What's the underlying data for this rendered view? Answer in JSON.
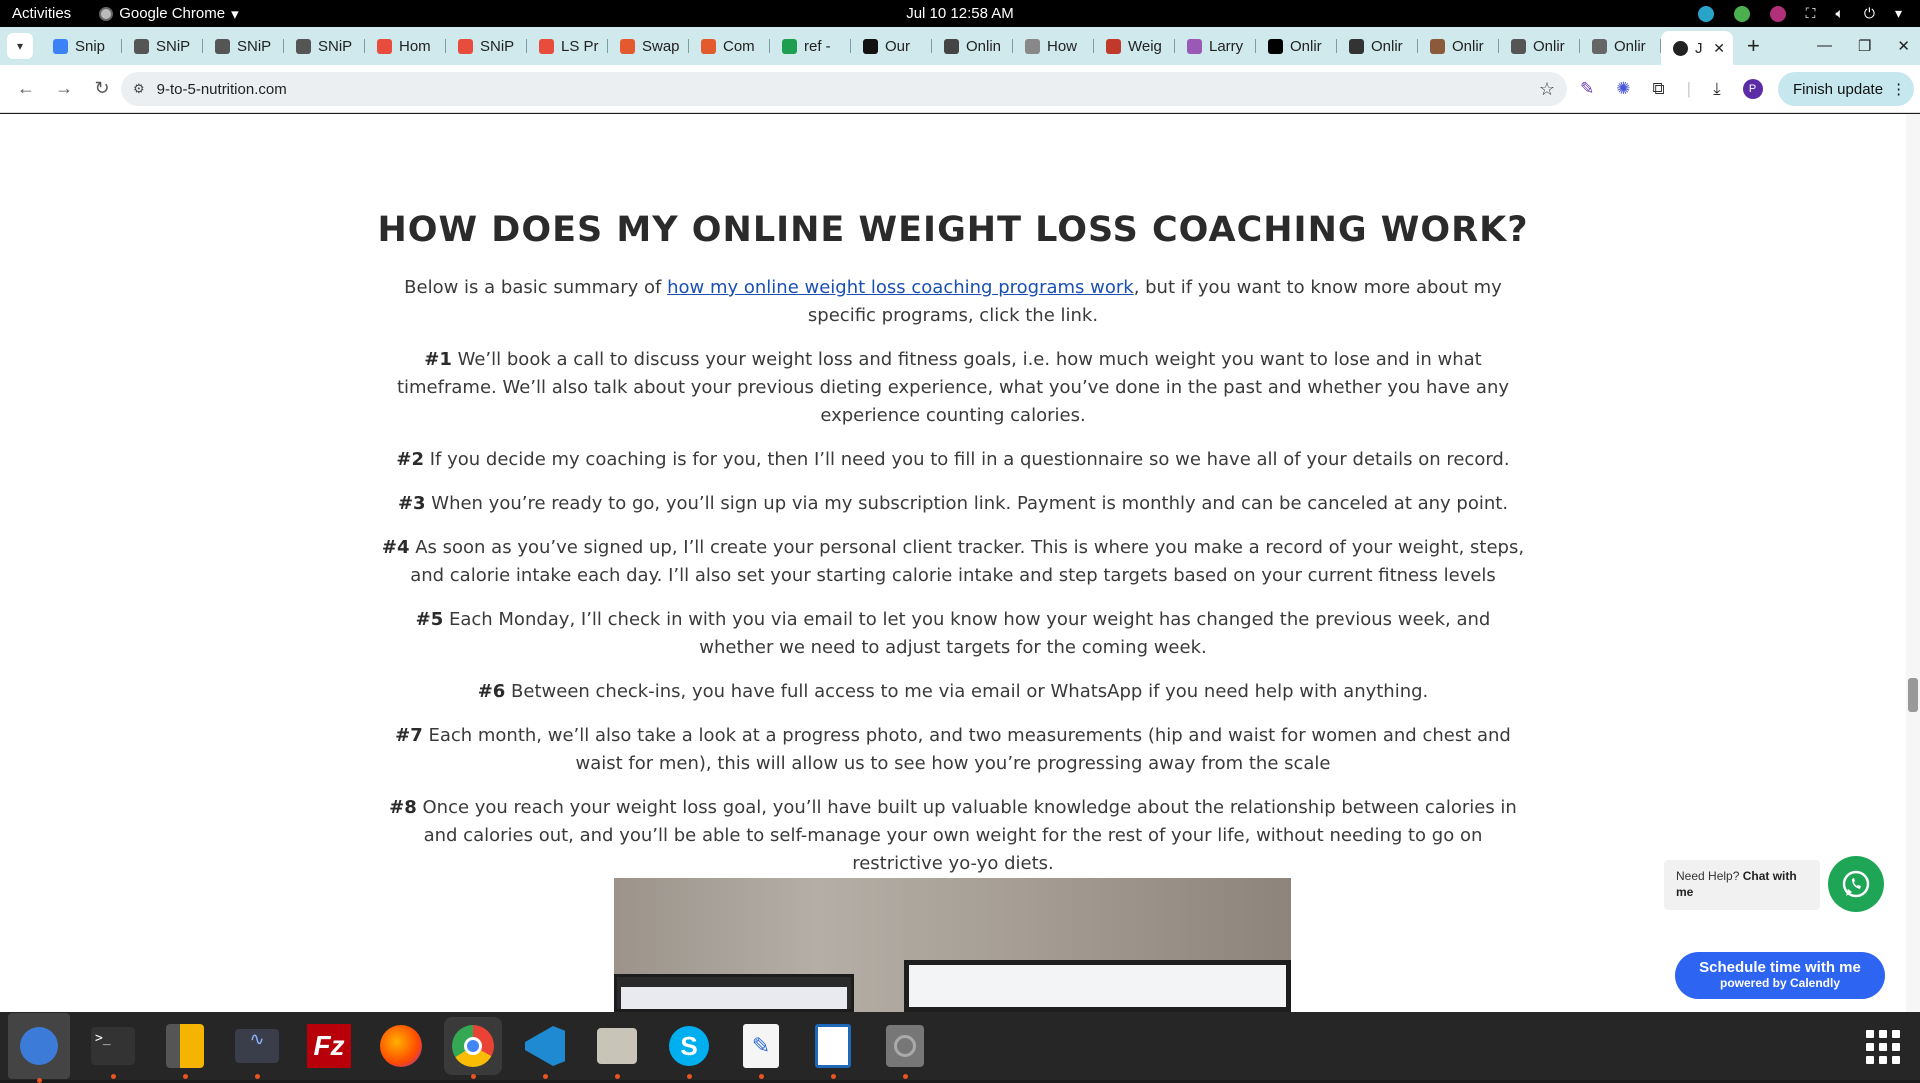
{
  "topbar": {
    "activities": "Activities",
    "app_name": "Google Chrome",
    "clock": "Jul 10  12:58 AM"
  },
  "tabs": [
    {
      "label": "Snip",
      "color": "#3b82f6"
    },
    {
      "label": "SNiP",
      "color": "#555555"
    },
    {
      "label": "SNiP",
      "color": "#555555"
    },
    {
      "label": "SNiP",
      "color": "#555555"
    },
    {
      "label": "Hom",
      "color": "#e74c3c"
    },
    {
      "label": "SNiP",
      "color": "#e74c3c"
    },
    {
      "label": "LS Pr",
      "color": "#e74c3c"
    },
    {
      "label": "Swap",
      "color": "#e25a2e"
    },
    {
      "label": "Com",
      "color": "#e25a2e"
    },
    {
      "label": "ref -",
      "color": "#1e9e4f"
    },
    {
      "label": "Our",
      "color": "#111111"
    },
    {
      "label": "Onlin",
      "color": "#444444"
    },
    {
      "label": "How",
      "color": "#888888"
    },
    {
      "label": "Weig",
      "color": "#c0392b"
    },
    {
      "label": "Larry",
      "color": "#9b59b6"
    },
    {
      "label": "Onlir",
      "color": "#000000"
    },
    {
      "label": "Onlir",
      "color": "#333333"
    },
    {
      "label": "Onlir",
      "color": "#8a5a3a"
    },
    {
      "label": "Onlir",
      "color": "#555555"
    },
    {
      "label": "Onlir",
      "color": "#666666"
    }
  ],
  "active_tab": {
    "label": "J"
  },
  "address": {
    "url": "9-to-5-nutrition.com"
  },
  "finish_update": "Finish update",
  "avatar_letter": "P",
  "article": {
    "heading": "HOW DOES MY ONLINE WEIGHT LOSS COACHING WORK?",
    "intro_before": "Below is a basic summary of ",
    "intro_link": "how my online weight loss coaching programs work",
    "intro_after": ", but if you want to know more about my specific programs, click the link.",
    "steps": [
      {
        "num": "#1",
        "text": " We’ll book a call to discuss your weight loss and fitness goals, i.e. how much weight you want to lose and in what timeframe. We’ll also talk about your previous dieting experience, what you’ve done in the past and whether you have any experience counting calories."
      },
      {
        "num": "#2",
        "text": " If you decide my coaching is for you, then I’ll need you to fill in a questionnaire so we have all of your details on record."
      },
      {
        "num": "#3",
        "text": " When you’re ready to go, you’ll sign up via my subscription link. Payment is monthly and can be canceled at any point."
      },
      {
        "num": "#4",
        "text": " As soon as you’ve signed up, I’ll create your personal client tracker. This is where you make a record of your weight, steps, and calorie intake each day. I’ll also set your starting calorie intake and step targets based on your current fitness levels"
      },
      {
        "num": "#5",
        "text": " Each Monday, I’ll check in with you via email to let you know how your weight has changed the previous week, and whether we need to adjust targets for the coming week."
      },
      {
        "num": "#6",
        "text": " Between check-ins, you have full access to me via email or WhatsApp if you need help with anything."
      },
      {
        "num": "#7",
        "text": " Each month, we’ll also take a look at a progress photo, and two measurements (hip and waist for women and chest and waist for men), this will allow us to see how you’re progressing away from the scale"
      },
      {
        "num": "#8",
        "text": " Once you reach your weight loss goal, you’ll have built up valuable knowledge about the relationship between calories in and calories out, and you’ll be able to self-manage your own weight for the rest of your life, without needing to go on restrictive yo-yo diets."
      }
    ]
  },
  "chat": {
    "prefix": "Need Help? ",
    "bold": "Chat with me"
  },
  "calendly": {
    "line1": "Schedule time with me",
    "line2": "powered by Calendly"
  },
  "dock_apps": [
    "thunderbird",
    "terminal",
    "calculator",
    "system-monitor",
    "filezilla",
    "firefox",
    "chrome",
    "vscode",
    "files",
    "skype",
    "text-editor",
    "libreoffice-writer",
    "disks"
  ]
}
